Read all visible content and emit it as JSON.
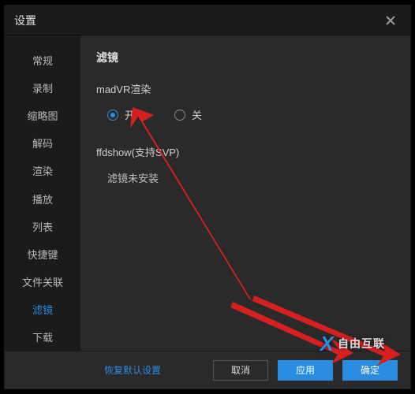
{
  "titlebar": {
    "title": "设置"
  },
  "sidebar": {
    "items": [
      {
        "label": "常规"
      },
      {
        "label": "录制"
      },
      {
        "label": "缩略图"
      },
      {
        "label": "解码"
      },
      {
        "label": "渲染"
      },
      {
        "label": "播放"
      },
      {
        "label": "列表"
      },
      {
        "label": "快捷键"
      },
      {
        "label": "文件关联"
      },
      {
        "label": "滤镜",
        "active": true
      },
      {
        "label": "下载"
      }
    ]
  },
  "main": {
    "section_title": "滤镜",
    "madvr_label": "madVR渲染",
    "radio_on": "开",
    "radio_off": "关",
    "ffdshow_label": "ffdshow(支持SVP)",
    "status_text": "滤镜未安装"
  },
  "footer": {
    "restore": "恢复默认设置",
    "cancel": "取消",
    "apply": "应用",
    "ok": "确定"
  },
  "watermark": {
    "brand": "X",
    "text": "自由互联"
  }
}
